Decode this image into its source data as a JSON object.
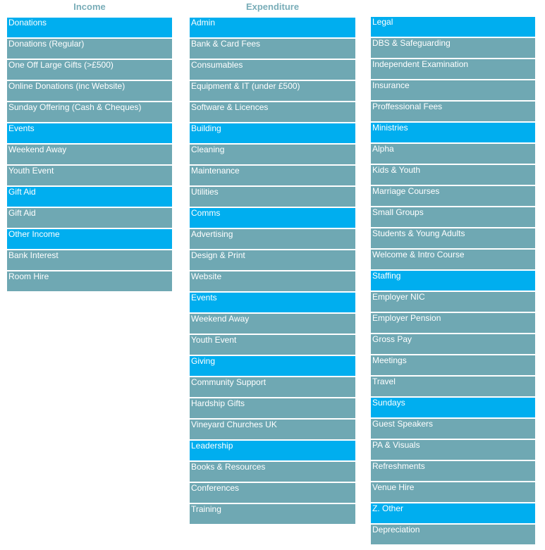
{
  "colors": {
    "group_row": "#00aeef",
    "item_row": "#6fa8b3",
    "column_title": "#79adb8",
    "row_text": "#ffffff"
  },
  "income": {
    "title": "Income",
    "rows": [
      {
        "label": "Donations",
        "type": "group"
      },
      {
        "label": "Donations (Regular)",
        "type": "item"
      },
      {
        "label": "One Off Large Gifts (>£500)",
        "type": "item"
      },
      {
        "label": "Online Donations (inc Website)",
        "type": "item"
      },
      {
        "label": "Sunday Offering (Cash & Cheques)",
        "type": "item"
      },
      {
        "label": "Events",
        "type": "group"
      },
      {
        "label": "Weekend Away",
        "type": "item"
      },
      {
        "label": "Youth Event",
        "type": "item"
      },
      {
        "label": "Gift Aid",
        "type": "group"
      },
      {
        "label": "Gift Aid",
        "type": "item"
      },
      {
        "label": "Other Income",
        "type": "group"
      },
      {
        "label": "Bank Interest",
        "type": "item"
      },
      {
        "label": "Room Hire",
        "type": "item"
      }
    ]
  },
  "expenditure": {
    "title": "Expenditure",
    "rows": [
      {
        "label": "Admin",
        "type": "group"
      },
      {
        "label": "Bank & Card Fees",
        "type": "item"
      },
      {
        "label": "Consumables",
        "type": "item"
      },
      {
        "label": "Equipment & IT (under £500)",
        "type": "item"
      },
      {
        "label": "Software & Licences",
        "type": "item"
      },
      {
        "label": "Building",
        "type": "group"
      },
      {
        "label": "Cleaning",
        "type": "item"
      },
      {
        "label": "Maintenance",
        "type": "item"
      },
      {
        "label": "Utilities",
        "type": "item"
      },
      {
        "label": "Comms",
        "type": "group"
      },
      {
        "label": "Advertising",
        "type": "item"
      },
      {
        "label": "Design & Print",
        "type": "item"
      },
      {
        "label": "Website",
        "type": "item"
      },
      {
        "label": "Events",
        "type": "group"
      },
      {
        "label": "Weekend Away",
        "type": "item"
      },
      {
        "label": "Youth Event",
        "type": "item"
      },
      {
        "label": "Giving",
        "type": "group"
      },
      {
        "label": "Community Support",
        "type": "item"
      },
      {
        "label": "Hardship Gifts",
        "type": "item"
      },
      {
        "label": "Vineyard Churches UK",
        "type": "item"
      },
      {
        "label": "Leadership",
        "type": "group"
      },
      {
        "label": "Books & Resources",
        "type": "item"
      },
      {
        "label": "Conferences",
        "type": "item"
      },
      {
        "label": "Training",
        "type": "item"
      }
    ]
  },
  "expenditure_continued": {
    "title": "",
    "rows": [
      {
        "label": "Legal",
        "type": "group"
      },
      {
        "label": "DBS & Safeguarding",
        "type": "item"
      },
      {
        "label": "Independent Examination",
        "type": "item"
      },
      {
        "label": "Insurance",
        "type": "item"
      },
      {
        "label": "Proffessional Fees",
        "type": "item"
      },
      {
        "label": "Ministries",
        "type": "group"
      },
      {
        "label": "Alpha",
        "type": "item"
      },
      {
        "label": "Kids & Youth",
        "type": "item"
      },
      {
        "label": "Marriage Courses",
        "type": "item"
      },
      {
        "label": "Small Groups",
        "type": "item"
      },
      {
        "label": "Students & Young Adults",
        "type": "item"
      },
      {
        "label": "Welcome & Intro Course",
        "type": "item"
      },
      {
        "label": "Staffing",
        "type": "group"
      },
      {
        "label": "Employer NIC",
        "type": "item"
      },
      {
        "label": "Employer Pension",
        "type": "item"
      },
      {
        "label": "Gross Pay",
        "type": "item"
      },
      {
        "label": "Meetings",
        "type": "item"
      },
      {
        "label": "Travel",
        "type": "item"
      },
      {
        "label": "Sundays",
        "type": "group"
      },
      {
        "label": "Guest Speakers",
        "type": "item"
      },
      {
        "label": "PA & Visuals",
        "type": "item"
      },
      {
        "label": "Refreshments",
        "type": "item"
      },
      {
        "label": "Venue Hire",
        "type": "item"
      },
      {
        "label": "Z. Other",
        "type": "group"
      },
      {
        "label": "Depreciation",
        "type": "item"
      }
    ]
  }
}
